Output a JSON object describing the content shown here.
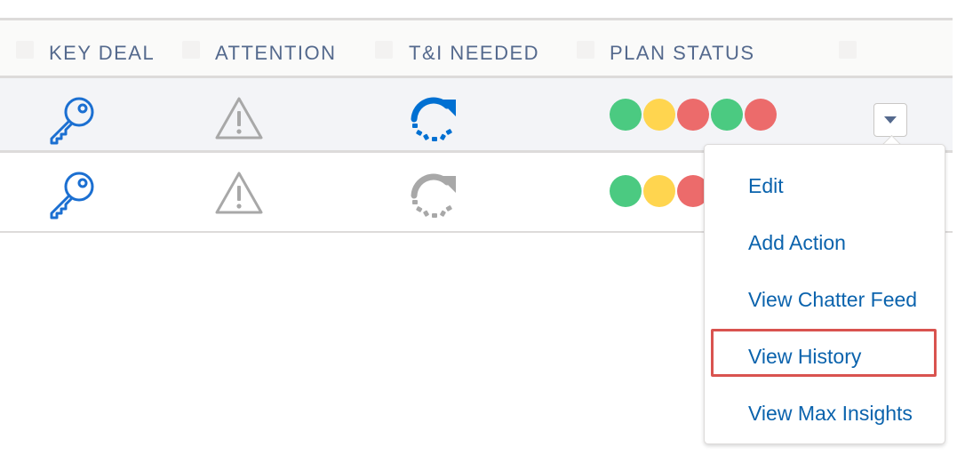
{
  "table": {
    "columns": [
      {
        "label": "KEY DEAL"
      },
      {
        "label": "ATTENTION"
      },
      {
        "label": "T&I NEEDED"
      },
      {
        "label": "PLAN STATUS"
      },
      {
        "label": ""
      }
    ],
    "rows": [
      {
        "key_deal_icon": "key-icon",
        "attention_icon": "warning-icon",
        "ti_needed_icon": "refresh-icon",
        "ti_needed_state": "active",
        "plan_status": [
          "green",
          "yellow",
          "red",
          "green",
          "red"
        ]
      },
      {
        "key_deal_icon": "key-icon",
        "attention_icon": "warning-icon",
        "ti_needed_icon": "refresh-icon",
        "ti_needed_state": "inactive",
        "plan_status": [
          "green",
          "yellow",
          "red"
        ]
      }
    ]
  },
  "row_actions": {
    "toggle_icon": "chevron-down-icon",
    "menu": {
      "items": [
        {
          "label": "Edit"
        },
        {
          "label": "Add Action"
        },
        {
          "label": "View Chatter Feed"
        },
        {
          "label": "View History",
          "highlighted": true
        },
        {
          "label": "View Max Insights"
        }
      ]
    }
  },
  "colors": {
    "green": "#4bca81",
    "yellow": "#ffd54f",
    "red": "#ec6b6b",
    "key_blue": "#1b6fd1",
    "refresh_active": "#0070d2",
    "refresh_inactive": "#a8a8a8",
    "warning_gray": "#a8a8a8",
    "link_blue": "#0b63ad",
    "highlight_red": "#d9534f"
  }
}
